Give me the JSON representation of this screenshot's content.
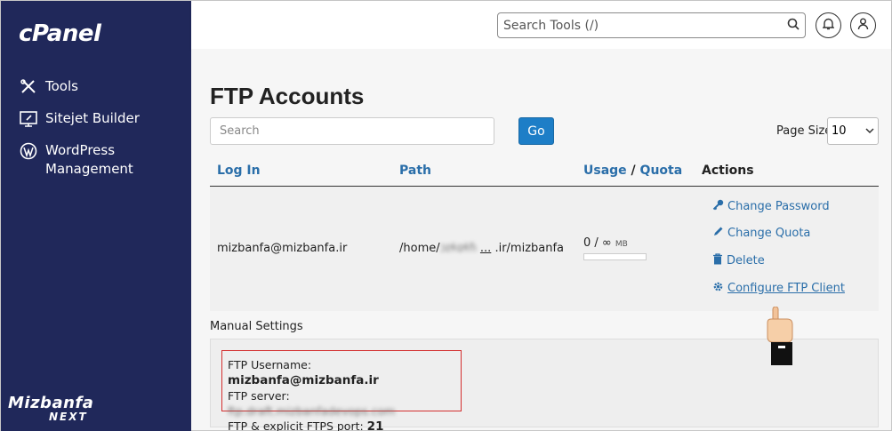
{
  "sidebar": {
    "logo": "cPanel",
    "items": [
      {
        "label": "Tools",
        "icon": "tools-icon"
      },
      {
        "label": "Sitejet Builder",
        "icon": "sitejet-icon"
      },
      {
        "label": "WordPress Management",
        "icon": "wordpress-icon"
      }
    ],
    "brand_line1": "Mizbanfa",
    "brand_line2": "NEXT"
  },
  "topbar": {
    "search_placeholder": "Search Tools (/)"
  },
  "page": {
    "title": "FTP Accounts",
    "search_placeholder": "Search",
    "go_label": "Go",
    "page_size_label": "Page Size",
    "page_size_value": "10"
  },
  "table": {
    "headers": {
      "login": "Log In",
      "path": "Path",
      "usage": "Usage",
      "slash": "/",
      "quota": "Quota",
      "actions": "Actions"
    },
    "rows": [
      {
        "login": "mizbanfa@mizbanfa.ir",
        "path_start": "/home/",
        "path_blur": "ɔɪɬɑɬɦ",
        "path_ellipsis": "...",
        "path_end": ".ir/mizbanfa",
        "usage": "0 / ∞",
        "usage_unit": "MB",
        "usage_fraction": 0
      }
    ],
    "actions": {
      "change_password": "Change Password",
      "change_quota": "Change Quota",
      "delete": "Delete",
      "configure": " Configure FTP Client"
    }
  },
  "manual": {
    "title": "Manual Settings",
    "username_label": "FTP Username: ",
    "username_value": "mizbanfa@mizbanfa.ir",
    "server_label": "FTP server: ",
    "server_value": "ftp.draft.mizbanfadevops.com",
    "port_label": "FTP & explicit FTPS port: ",
    "port_value": "21"
  },
  "colors": {
    "sidebar_bg": "#20285a",
    "link": "#2a6ea9",
    "go_button": "#1d7ec7",
    "highlight_border": "#d32f2f"
  }
}
